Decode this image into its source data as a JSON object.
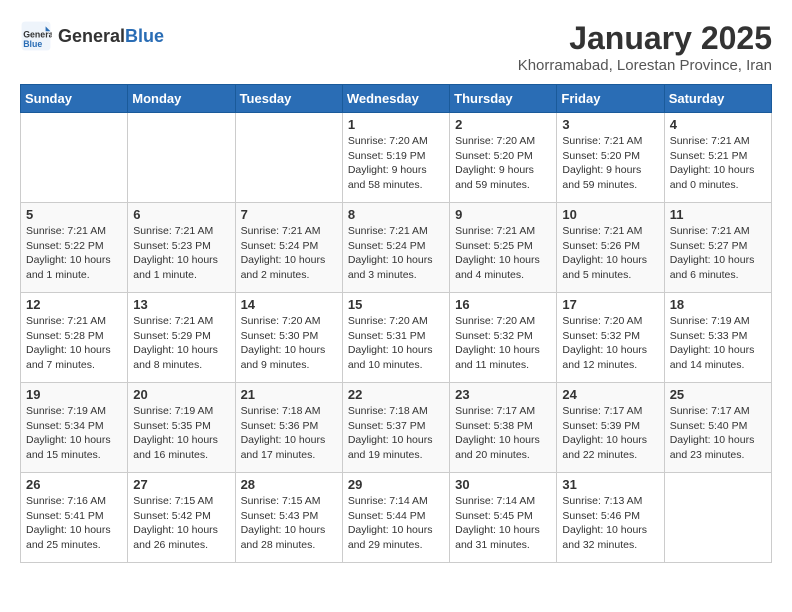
{
  "logo": {
    "general": "General",
    "blue": "Blue"
  },
  "title": "January 2025",
  "subtitle": "Khorramabad, Lorestan Province, Iran",
  "headers": [
    "Sunday",
    "Monday",
    "Tuesday",
    "Wednesday",
    "Thursday",
    "Friday",
    "Saturday"
  ],
  "weeks": [
    [
      {
        "day": "",
        "info": ""
      },
      {
        "day": "",
        "info": ""
      },
      {
        "day": "",
        "info": ""
      },
      {
        "day": "1",
        "info": "Sunrise: 7:20 AM\nSunset: 5:19 PM\nDaylight: 9 hours\nand 58 minutes."
      },
      {
        "day": "2",
        "info": "Sunrise: 7:20 AM\nSunset: 5:20 PM\nDaylight: 9 hours\nand 59 minutes."
      },
      {
        "day": "3",
        "info": "Sunrise: 7:21 AM\nSunset: 5:20 PM\nDaylight: 9 hours\nand 59 minutes."
      },
      {
        "day": "4",
        "info": "Sunrise: 7:21 AM\nSunset: 5:21 PM\nDaylight: 10 hours\nand 0 minutes."
      }
    ],
    [
      {
        "day": "5",
        "info": "Sunrise: 7:21 AM\nSunset: 5:22 PM\nDaylight: 10 hours\nand 1 minute."
      },
      {
        "day": "6",
        "info": "Sunrise: 7:21 AM\nSunset: 5:23 PM\nDaylight: 10 hours\nand 1 minute."
      },
      {
        "day": "7",
        "info": "Sunrise: 7:21 AM\nSunset: 5:24 PM\nDaylight: 10 hours\nand 2 minutes."
      },
      {
        "day": "8",
        "info": "Sunrise: 7:21 AM\nSunset: 5:24 PM\nDaylight: 10 hours\nand 3 minutes."
      },
      {
        "day": "9",
        "info": "Sunrise: 7:21 AM\nSunset: 5:25 PM\nDaylight: 10 hours\nand 4 minutes."
      },
      {
        "day": "10",
        "info": "Sunrise: 7:21 AM\nSunset: 5:26 PM\nDaylight: 10 hours\nand 5 minutes."
      },
      {
        "day": "11",
        "info": "Sunrise: 7:21 AM\nSunset: 5:27 PM\nDaylight: 10 hours\nand 6 minutes."
      }
    ],
    [
      {
        "day": "12",
        "info": "Sunrise: 7:21 AM\nSunset: 5:28 PM\nDaylight: 10 hours\nand 7 minutes."
      },
      {
        "day": "13",
        "info": "Sunrise: 7:21 AM\nSunset: 5:29 PM\nDaylight: 10 hours\nand 8 minutes."
      },
      {
        "day": "14",
        "info": "Sunrise: 7:20 AM\nSunset: 5:30 PM\nDaylight: 10 hours\nand 9 minutes."
      },
      {
        "day": "15",
        "info": "Sunrise: 7:20 AM\nSunset: 5:31 PM\nDaylight: 10 hours\nand 10 minutes."
      },
      {
        "day": "16",
        "info": "Sunrise: 7:20 AM\nSunset: 5:32 PM\nDaylight: 10 hours\nand 11 minutes."
      },
      {
        "day": "17",
        "info": "Sunrise: 7:20 AM\nSunset: 5:32 PM\nDaylight: 10 hours\nand 12 minutes."
      },
      {
        "day": "18",
        "info": "Sunrise: 7:19 AM\nSunset: 5:33 PM\nDaylight: 10 hours\nand 14 minutes."
      }
    ],
    [
      {
        "day": "19",
        "info": "Sunrise: 7:19 AM\nSunset: 5:34 PM\nDaylight: 10 hours\nand 15 minutes."
      },
      {
        "day": "20",
        "info": "Sunrise: 7:19 AM\nSunset: 5:35 PM\nDaylight: 10 hours\nand 16 minutes."
      },
      {
        "day": "21",
        "info": "Sunrise: 7:18 AM\nSunset: 5:36 PM\nDaylight: 10 hours\nand 17 minutes."
      },
      {
        "day": "22",
        "info": "Sunrise: 7:18 AM\nSunset: 5:37 PM\nDaylight: 10 hours\nand 19 minutes."
      },
      {
        "day": "23",
        "info": "Sunrise: 7:17 AM\nSunset: 5:38 PM\nDaylight: 10 hours\nand 20 minutes."
      },
      {
        "day": "24",
        "info": "Sunrise: 7:17 AM\nSunset: 5:39 PM\nDaylight: 10 hours\nand 22 minutes."
      },
      {
        "day": "25",
        "info": "Sunrise: 7:17 AM\nSunset: 5:40 PM\nDaylight: 10 hours\nand 23 minutes."
      }
    ],
    [
      {
        "day": "26",
        "info": "Sunrise: 7:16 AM\nSunset: 5:41 PM\nDaylight: 10 hours\nand 25 minutes."
      },
      {
        "day": "27",
        "info": "Sunrise: 7:15 AM\nSunset: 5:42 PM\nDaylight: 10 hours\nand 26 minutes."
      },
      {
        "day": "28",
        "info": "Sunrise: 7:15 AM\nSunset: 5:43 PM\nDaylight: 10 hours\nand 28 minutes."
      },
      {
        "day": "29",
        "info": "Sunrise: 7:14 AM\nSunset: 5:44 PM\nDaylight: 10 hours\nand 29 minutes."
      },
      {
        "day": "30",
        "info": "Sunrise: 7:14 AM\nSunset: 5:45 PM\nDaylight: 10 hours\nand 31 minutes."
      },
      {
        "day": "31",
        "info": "Sunrise: 7:13 AM\nSunset: 5:46 PM\nDaylight: 10 hours\nand 32 minutes."
      },
      {
        "day": "",
        "info": ""
      }
    ]
  ]
}
